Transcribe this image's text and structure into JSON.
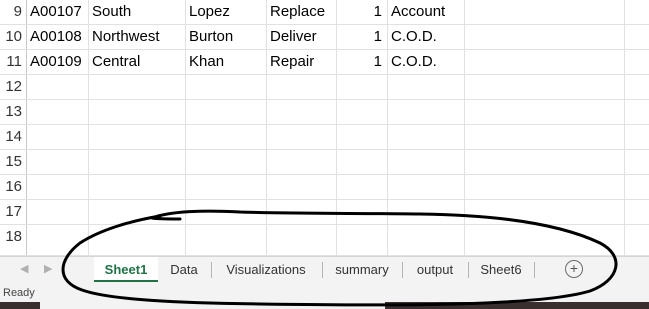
{
  "rows": [
    {
      "num": "9",
      "cells": [
        "A00107",
        "South",
        "Lopez",
        "Replace",
        "1",
        "Account"
      ]
    },
    {
      "num": "10",
      "cells": [
        "A00108",
        "Northwest",
        "Burton",
        "Deliver",
        "1",
        "C.O.D."
      ]
    },
    {
      "num": "11",
      "cells": [
        "A00109",
        "Central",
        "Khan",
        "Repair",
        "1",
        "C.O.D."
      ]
    },
    {
      "num": "12",
      "cells": [
        "",
        "",
        "",
        "",
        "",
        ""
      ]
    },
    {
      "num": "13",
      "cells": [
        "",
        "",
        "",
        "",
        "",
        ""
      ]
    },
    {
      "num": "14",
      "cells": [
        "",
        "",
        "",
        "",
        "",
        ""
      ]
    },
    {
      "num": "15",
      "cells": [
        "",
        "",
        "",
        "",
        "",
        ""
      ]
    },
    {
      "num": "16",
      "cells": [
        "",
        "",
        "",
        "",
        "",
        ""
      ]
    },
    {
      "num": "17",
      "cells": [
        "",
        "",
        "",
        "",
        "",
        ""
      ]
    },
    {
      "num": "18",
      "cells": [
        "",
        "",
        "",
        "",
        "",
        ""
      ]
    }
  ],
  "sheet_tabs": [
    {
      "label": "Sheet1",
      "active": true
    },
    {
      "label": "Data",
      "active": false
    },
    {
      "label": "Visualizations",
      "active": false
    },
    {
      "label": "summary",
      "active": false
    },
    {
      "label": "output",
      "active": false
    },
    {
      "label": "Sheet6",
      "active": false
    }
  ],
  "add_sheet_symbol": "+",
  "status": {
    "text": "Ready"
  },
  "colors": {
    "active_tab": "#217346",
    "scribble": "#000000"
  }
}
